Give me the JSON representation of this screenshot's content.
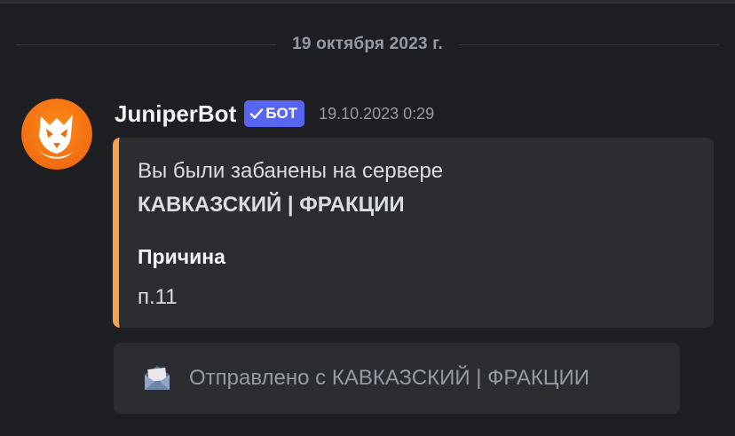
{
  "divider": {
    "date": "19 октября 2023 г."
  },
  "message": {
    "avatar_icon": "fox-icon",
    "username": "JuniperBot",
    "bot_tag": "БОТ",
    "timestamp": "19.10.2023 0:29",
    "accent_color": "#f6a34a"
  },
  "embed": {
    "description": "Вы были забанены на сервере",
    "server_name": "КАВКАЗСКИЙ | ФРАКЦИИ",
    "field_name": "Причина",
    "field_value": "п.11"
  },
  "sent_from": {
    "icon": "mail-icon",
    "text": "Отправлено с КАВКАЗСКИЙ | ФРАКЦИИ"
  }
}
